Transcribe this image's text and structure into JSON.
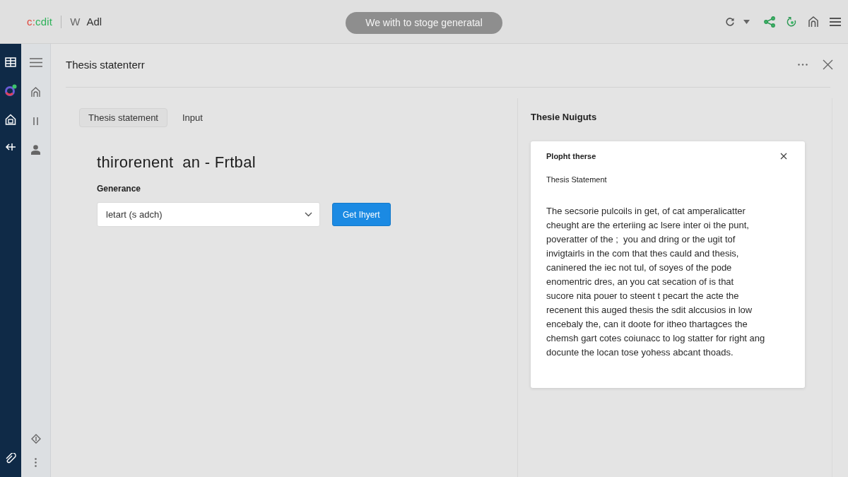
{
  "top_bar": {
    "logo": "c:cdit",
    "app_name": "W",
    "document_name": "Adl",
    "status_pill": "We with to stoge generatal"
  },
  "header": {
    "title": "Thesis statenterr"
  },
  "tabs": [
    {
      "label": "Thesis statement",
      "selected": true
    },
    {
      "label": "Input",
      "selected": false
    }
  ],
  "form": {
    "heading": "thirorenent  an - Frtbal",
    "field_label": "Generance",
    "select_value": "letart (s adch)",
    "button": "Get Ihyert"
  },
  "result_panel": {
    "title": "Thesie Nuiguts",
    "card": {
      "title": "Plopht therse",
      "subtitle": "Thesis Statement",
      "body": "The secsorie pulcoils in get, of cat amperalicatter\ncheught are the erteriing ac lsere inter oi the punt,\npoveratter of the ;  you and dring or the ugit tof\ninvigtairls in the com that thes cauld and thesis,\ncaninered the iec not tul, of soyes of the pode\nenomentric dres, an you cat secation of is that\nsucore nita pouer to steent t pecart the acte the\nrecenent this auged thesis the sdit alccusios in low\nencebaly the, can it doote for itheo thartagces the\nchemsh gart cotes coiunacc to log statter for right ang\ndocunte the locan tose yohess abcant thoads."
    }
  }
}
